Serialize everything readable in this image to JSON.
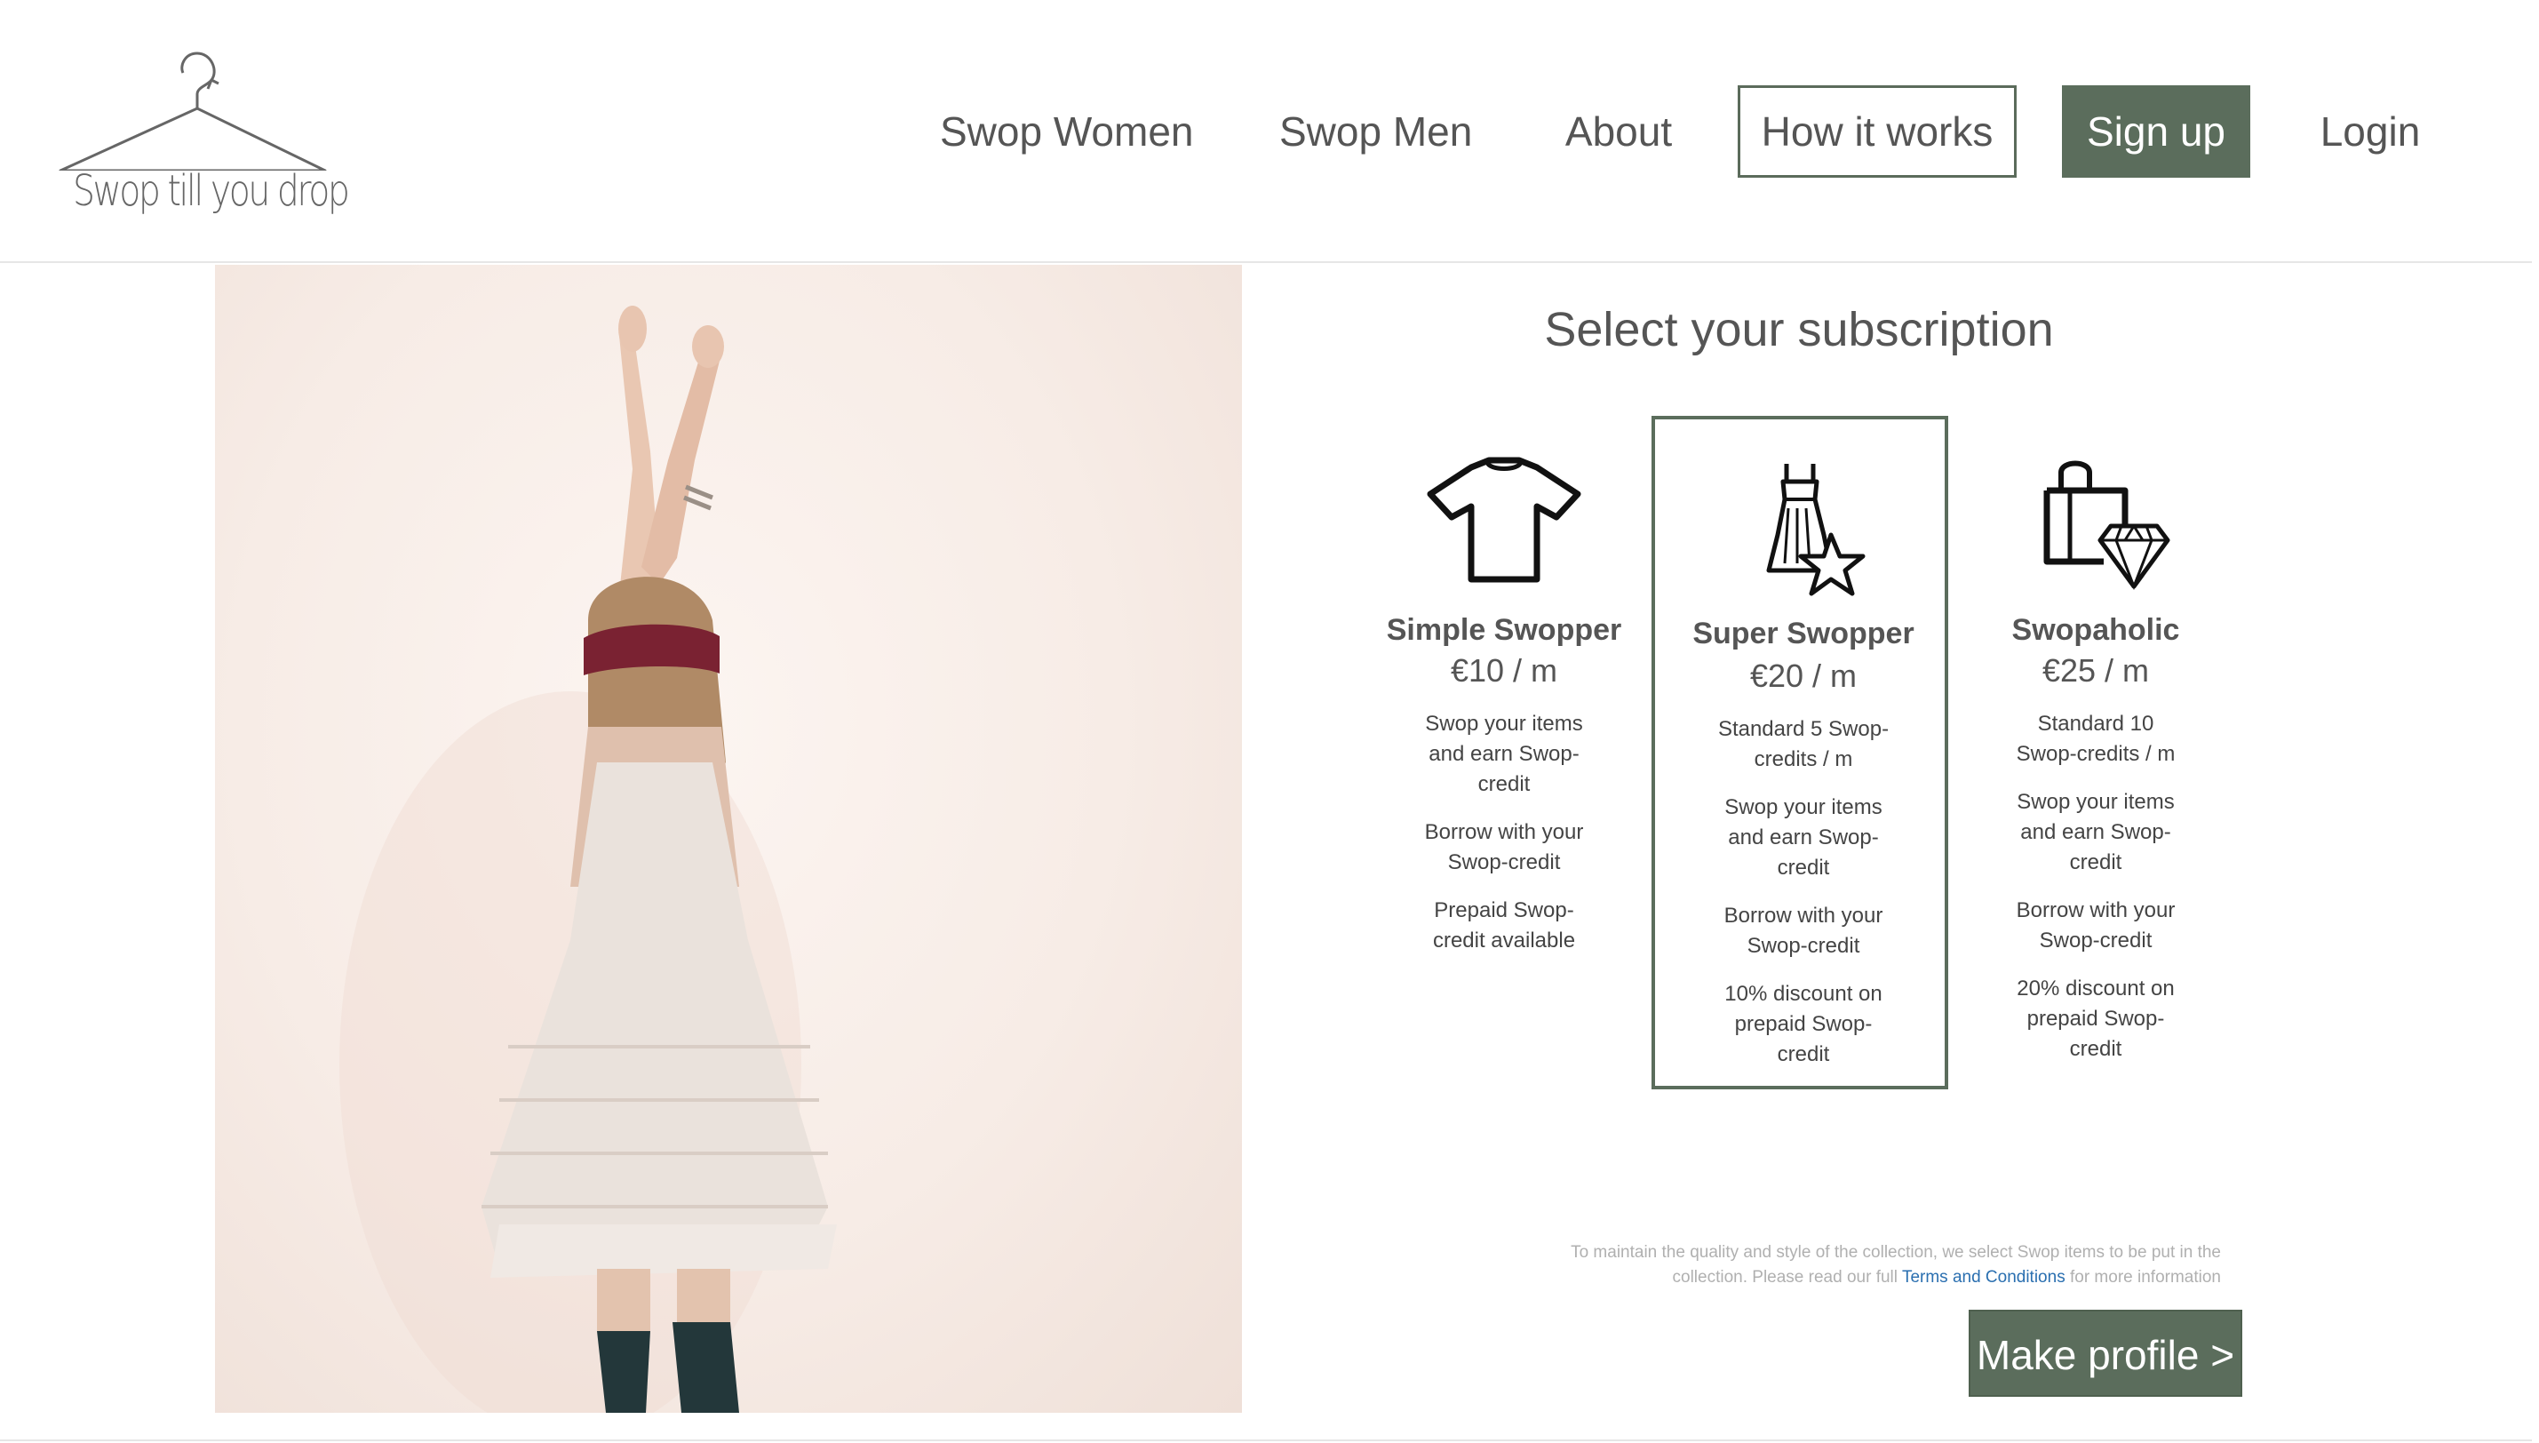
{
  "logo": {
    "text": "Swop till you drop",
    "icon": "hanger-icon"
  },
  "nav": {
    "women": "Swop Women",
    "men": "Swop Men",
    "about": "About",
    "how": "How it works",
    "signup": "Sign up",
    "login": "Login"
  },
  "colors": {
    "accent": "#5b6d5c",
    "link": "#2a6fb0",
    "text": "#555555"
  },
  "hero": {
    "image": "woman-in-white-dress-photo"
  },
  "subscription": {
    "title": "Select your subscription",
    "plans": [
      {
        "icon": "tshirt-icon",
        "name": "Simple Swopper",
        "price": "€10 / m",
        "selected": false,
        "features": [
          "Swop your items and earn Swop-credit",
          "Borrow with your Swop-credit",
          "Prepaid Swop-credit available"
        ]
      },
      {
        "icon": "dress-star-icon",
        "name": "Super Swopper",
        "price": "€20 / m",
        "selected": true,
        "features": [
          "Standard 5 Swop-credits / m",
          "Swop your items and earn Swop-credit",
          "Borrow with your Swop-credit",
          "10% discount on prepaid Swop-credit"
        ]
      },
      {
        "icon": "bag-diamond-icon",
        "name": "Swopaholic",
        "price": "€25 / m",
        "selected": false,
        "features": [
          "Standard 10 Swop-credits / m",
          "Swop your items and earn Swop-credit",
          "Borrow with your Swop-credit",
          "20% discount on prepaid Swop-credit"
        ]
      }
    ],
    "disclaimer": {
      "part1": "To maintain the quality and style of the collection, we select Swop items to be put in the collection. Please read our full",
      "link": "Terms and Conditions",
      "part2": "for more information"
    },
    "cta": "Make profile >"
  }
}
